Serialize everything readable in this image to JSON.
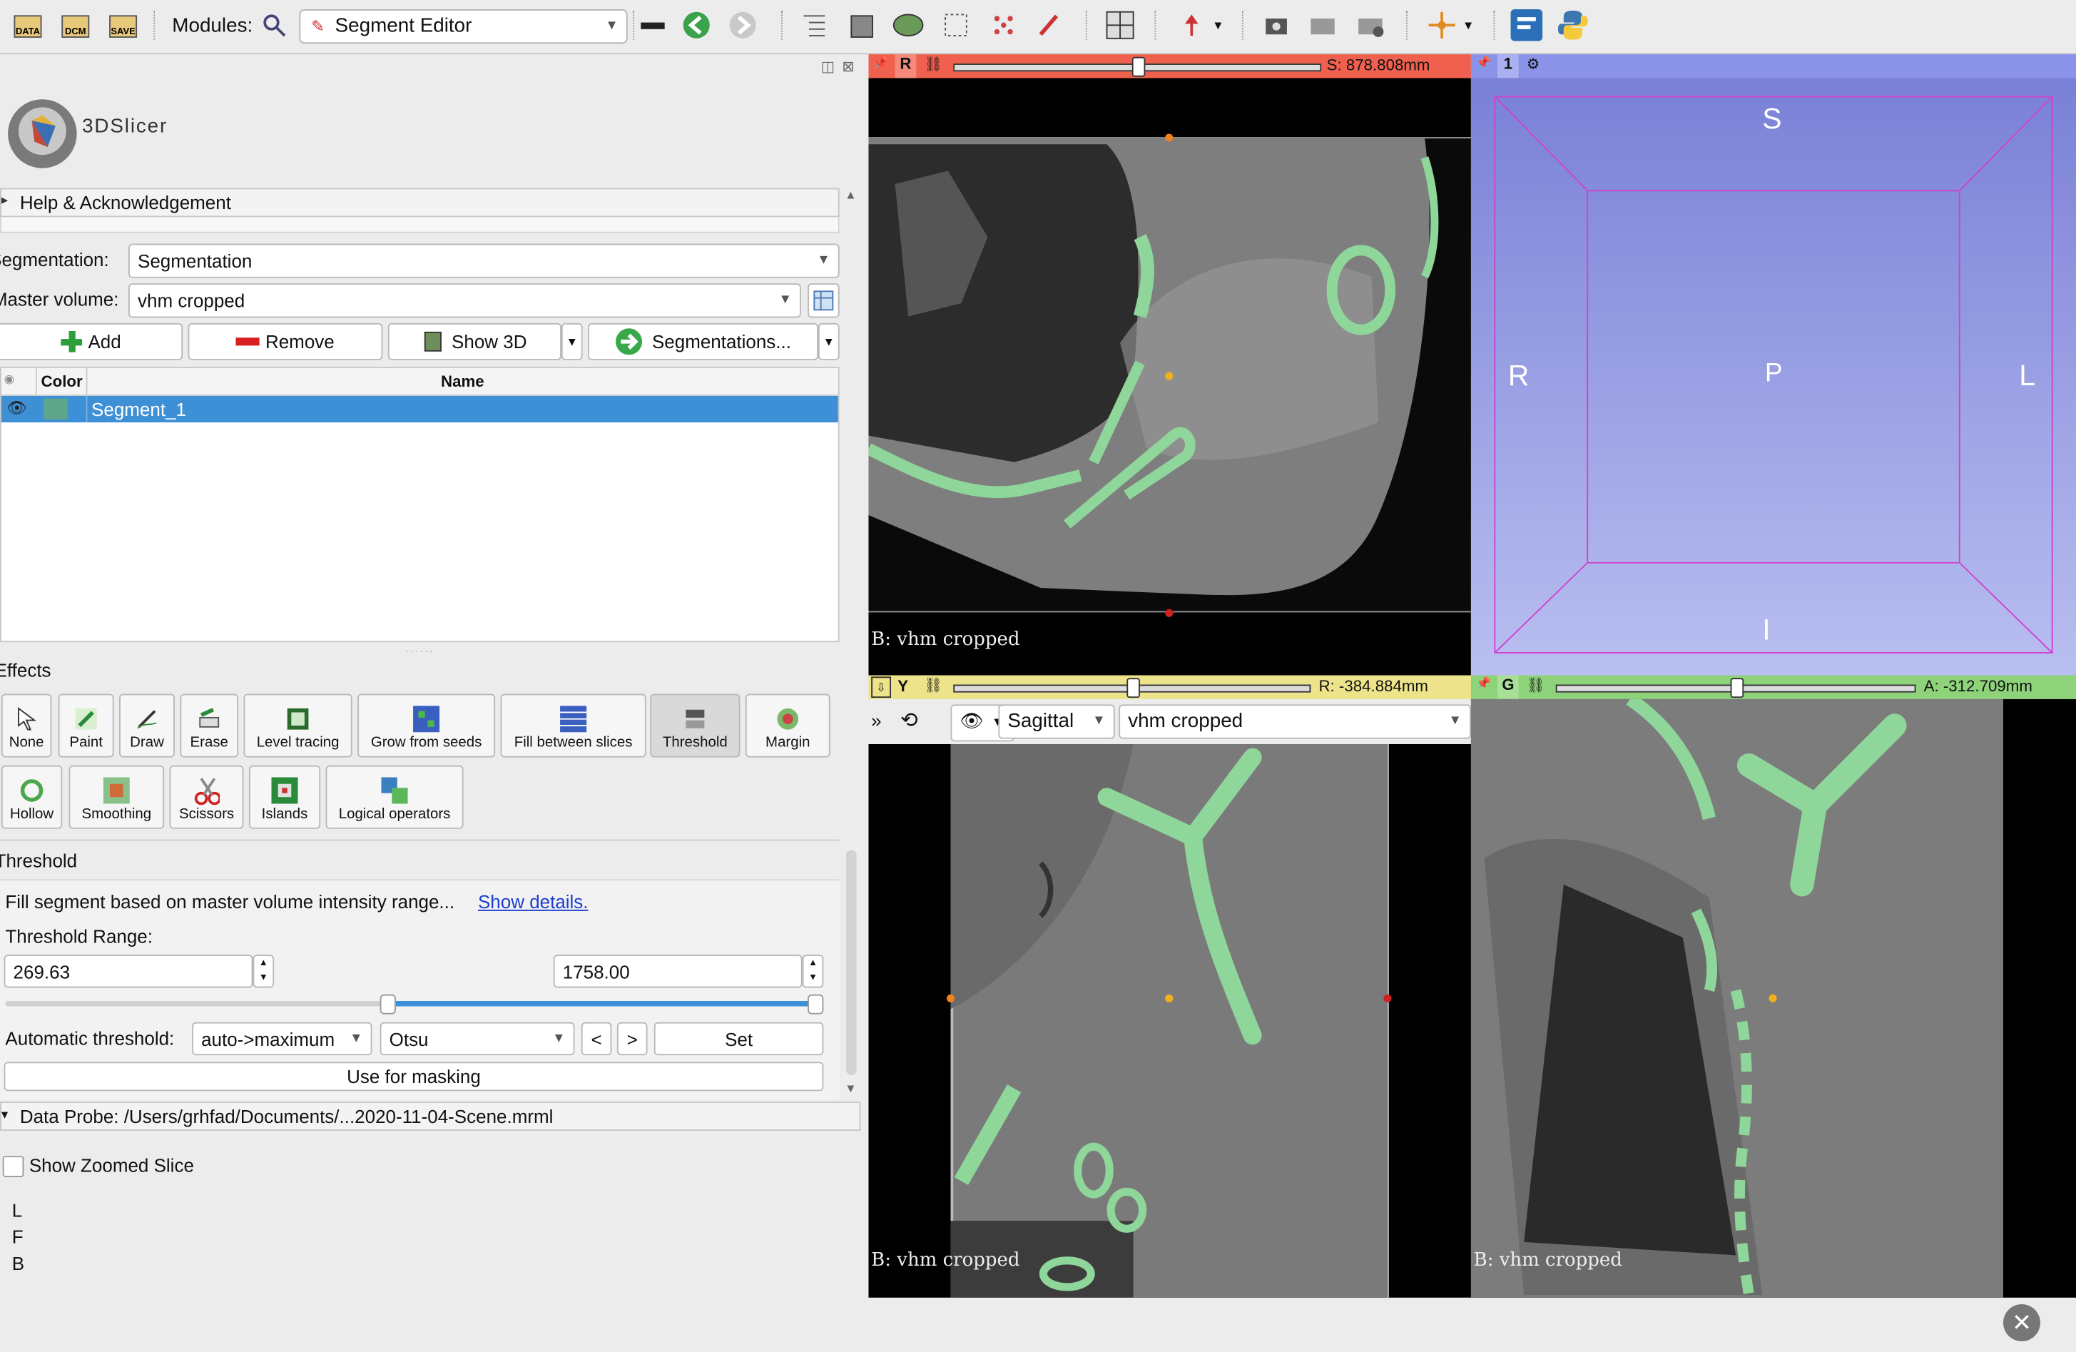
{
  "toolbar": {
    "data_icon": "DATA",
    "dcm_icon": "DCM",
    "save_icon": "SAVE",
    "modules_label": "Modules:",
    "module_selected": "Segment Editor"
  },
  "app": {
    "logo_text": "3DSlicer"
  },
  "help": {
    "label": "Help & Acknowledgement"
  },
  "segmentation": {
    "label": "Segmentation:",
    "value": "Segmentation",
    "master_label": "Master volume:",
    "master_value": "vhm cropped"
  },
  "actions": {
    "add": "Add",
    "remove": "Remove",
    "show3d": "Show 3D",
    "segmentations": "Segmentations..."
  },
  "table": {
    "col_color": "Color",
    "col_name": "Name",
    "rows": [
      {
        "name": "Segment_1",
        "color": "#5fa58c"
      }
    ]
  },
  "effects": {
    "title": "Effects",
    "row1": [
      "None",
      "Paint",
      "Draw",
      "Erase",
      "Level tracing",
      "Grow from seeds",
      "Fill between slices",
      "Threshold",
      "Margin"
    ],
    "row2": [
      "Hollow",
      "Smoothing",
      "Scissors",
      "Islands",
      "Logical operators"
    ]
  },
  "threshold": {
    "title": "Threshold",
    "description": "Fill segment based on master volume intensity range...",
    "details_link": "Show details.",
    "range_label": "Threshold Range:",
    "min": "269.63",
    "max": "1758.00",
    "auto_label": "Automatic threshold:",
    "auto_mode": "auto->maximum",
    "auto_method": "Otsu",
    "prev": "<",
    "next": ">",
    "set": "Set",
    "masking": "Use for masking"
  },
  "probe": {
    "label": "Data Probe: /Users/grhfad/Documents/...2020-11-04-Scene.mrml",
    "zoom_label": "Show Zoomed Slice",
    "lines": [
      "L",
      "F",
      "B"
    ]
  },
  "views": {
    "red": {
      "letter": "R",
      "offset": "S: 878.808mm",
      "bg_label": "B: vhm cropped",
      "slider_pos": 0.5
    },
    "yellow": {
      "letter": "Y",
      "offset": "R: -384.884mm",
      "bg_label": "B: vhm cropped",
      "orientation": "Sagittal",
      "volume": "vhm cropped",
      "slider_pos": 0.5
    },
    "green": {
      "letter": "G",
      "offset": "A: -312.709mm",
      "bg_label": "B: vhm cropped",
      "slider_pos": 0.5
    },
    "threed": {
      "number": "1",
      "s": "S",
      "i": "I",
      "r": "R",
      "l": "L",
      "p": "P"
    }
  },
  "colors": {
    "red_bar": "#f0604f",
    "yellow_bar": "#ede38a",
    "green_bar": "#8ed27a",
    "blue_bar": "#8a93e8",
    "selection": "#3d8fd6",
    "segment_green": "#7fd08c"
  }
}
